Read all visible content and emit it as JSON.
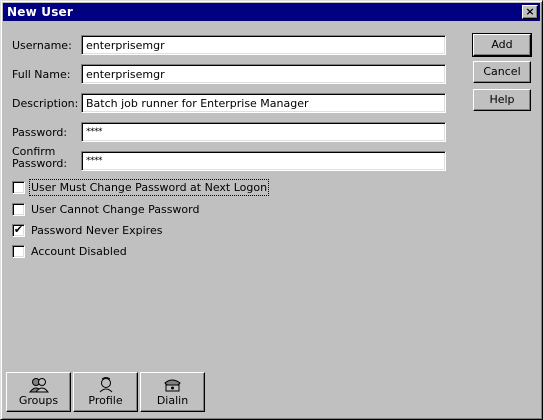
{
  "window": {
    "title": "New User",
    "close_glyph": "×"
  },
  "form": {
    "username": {
      "label": "Username:",
      "value": "enterprisemgr"
    },
    "fullname": {
      "label": "Full Name:",
      "value": "enterprisemgr"
    },
    "description": {
      "label": "Description:",
      "value": "Batch job runner for Enterprise Manager"
    },
    "password": {
      "label": "Password:",
      "value": "****"
    },
    "confirm": {
      "label_line1": "Confirm",
      "label_line2": "Password:",
      "value": "****"
    }
  },
  "checkboxes": [
    {
      "label": "User Must Change Password at Next Logon",
      "checked": false,
      "mark": ""
    },
    {
      "label": "User Cannot Change Password",
      "checked": false,
      "mark": ""
    },
    {
      "label": "Password Never Expires",
      "checked": true,
      "mark": "✔"
    },
    {
      "label": "Account Disabled",
      "checked": false,
      "mark": ""
    }
  ],
  "buttons": {
    "add": "Add",
    "cancel": "Cancel",
    "help": "Help"
  },
  "bottom_buttons": [
    {
      "label": "Groups",
      "icon": "groups-icon"
    },
    {
      "label": "Profile",
      "icon": "profile-icon"
    },
    {
      "label": "Dialin",
      "icon": "dialin-icon"
    }
  ],
  "colors": {
    "titlebar": "#000080",
    "face": "#c0c0c0"
  }
}
